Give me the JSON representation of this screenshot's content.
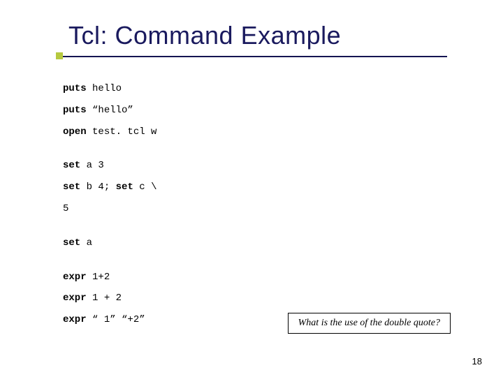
{
  "slide": {
    "title": "Tcl: Command Example",
    "code": {
      "line1_kw": "puts",
      "line1_rest": " hello",
      "line2_kw": "puts",
      "line2_rest": " “hello”",
      "line3_kw": "open",
      "line3_rest": " test. tcl w",
      "line4_kw": "set",
      "line4_rest": " a 3",
      "line5a_kw": "set",
      "line5a_rest": " b 4; ",
      "line5b_kw": "set",
      "line5b_rest": " c \\",
      "line6": "5",
      "line7_kw": "set",
      "line7_rest": " a",
      "line8_kw": "expr",
      "line8_rest": " 1+2",
      "line9_kw": "expr",
      "line9_rest": " 1 + 2",
      "line10_kw": "expr",
      "line10_rest": " “ 1” “+2”"
    },
    "callout": "What is the use of the double quote?",
    "page_number": "18"
  }
}
